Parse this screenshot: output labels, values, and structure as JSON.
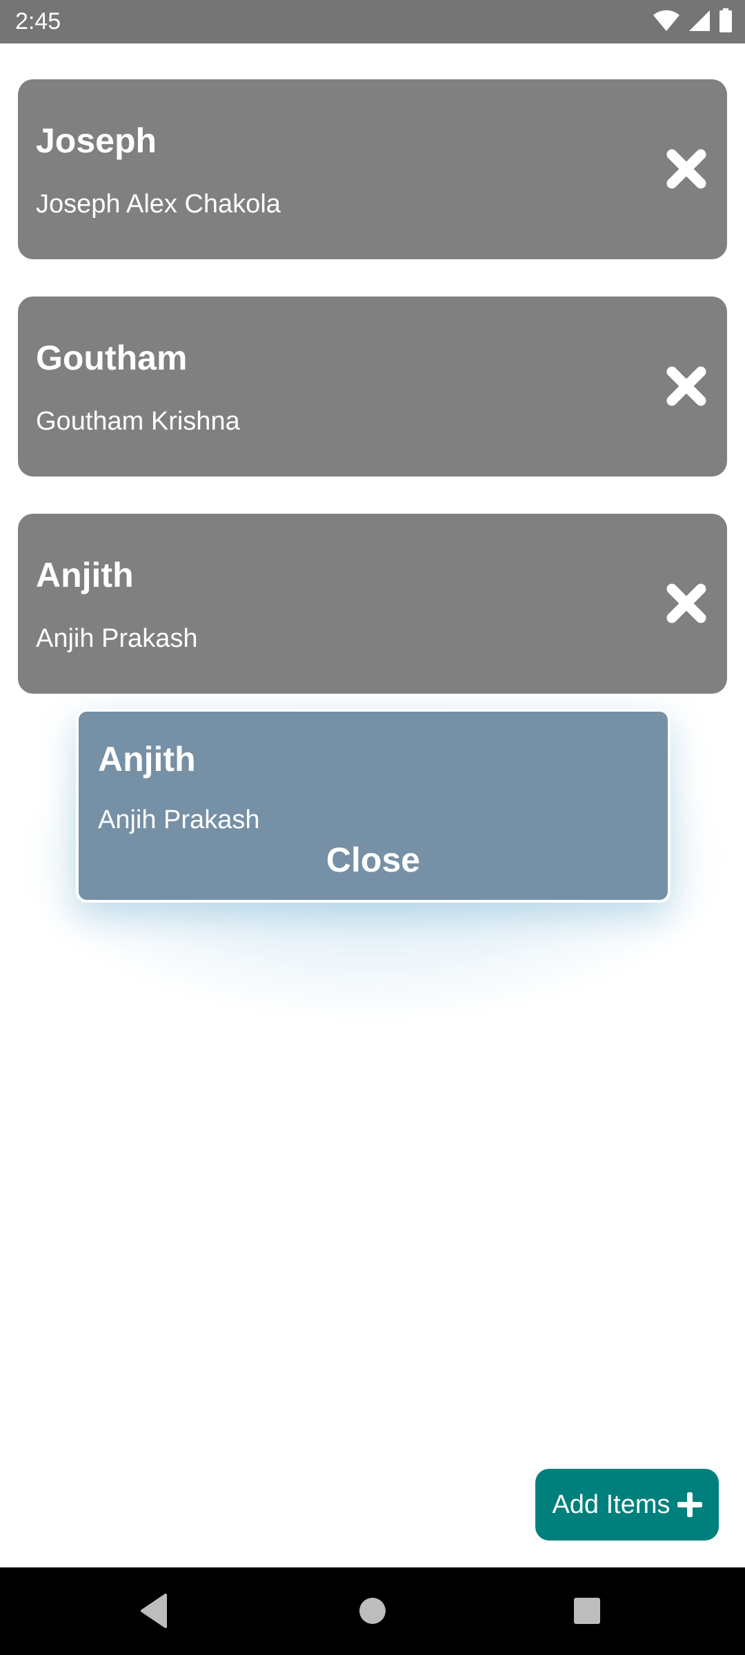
{
  "status_bar": {
    "time": "2:45",
    "icons": [
      "wifi-icon",
      "signal-icon",
      "battery-icon"
    ]
  },
  "cards": [
    {
      "title": "Joseph",
      "subtitle": "Joseph Alex Chakola",
      "action_icon": "close-icon"
    },
    {
      "title": "Goutham",
      "subtitle": "Goutham Krishna",
      "action_icon": "close-icon"
    },
    {
      "title": "Anjith",
      "subtitle": "Anjih Prakash",
      "action_icon": "close-icon"
    }
  ],
  "popup": {
    "title": "Anjith",
    "subtitle": "Anjih Prakash",
    "close_label": "Close"
  },
  "add_button": {
    "label": "Add Items",
    "icon": "plus-icon"
  },
  "nav_bar": {
    "icons": [
      "back-icon",
      "home-icon",
      "recents-icon"
    ]
  },
  "colors": {
    "status_bar": "#757575",
    "card_bg": "#808080",
    "popup_bg": "#7690a6",
    "accent": "#00807d",
    "nav_bar": "#000000"
  }
}
